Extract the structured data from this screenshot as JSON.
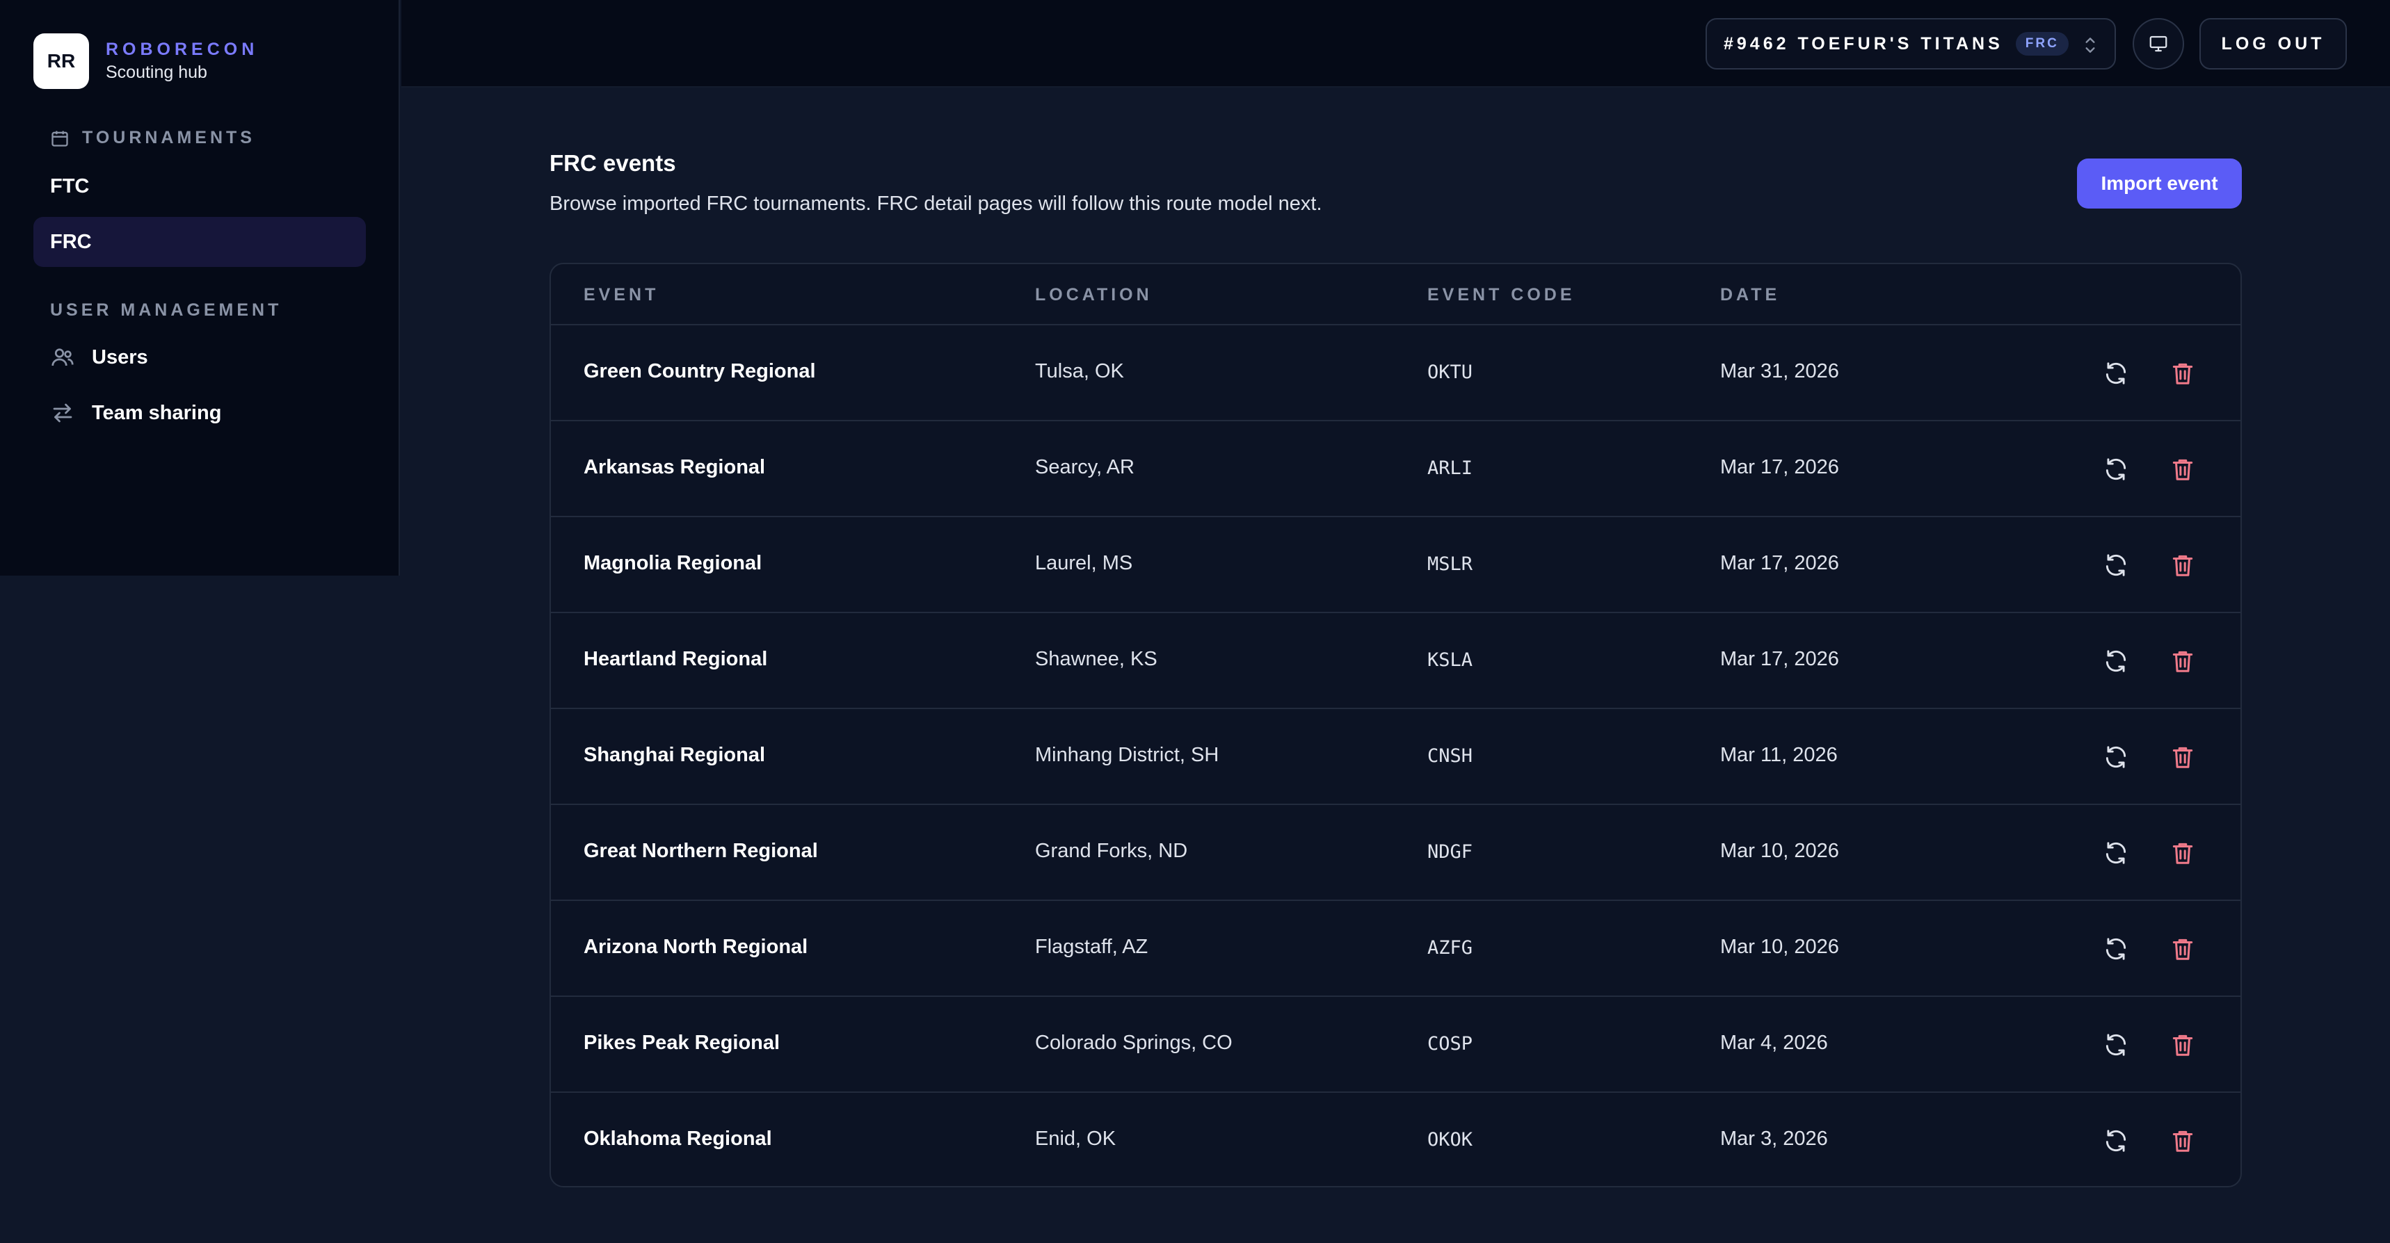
{
  "brand": {
    "logo": "RR",
    "name": "ROBORECON",
    "subtitle": "Scouting hub"
  },
  "sidebar": {
    "tournaments_label": "TOURNAMENTS",
    "tournaments": [
      {
        "label": "FTC",
        "active": false
      },
      {
        "label": "FRC",
        "active": true
      }
    ],
    "user_management_label": "USER MANAGEMENT",
    "user_items": [
      {
        "label": "Users",
        "icon": "users-icon"
      },
      {
        "label": "Team sharing",
        "icon": "swap-arrows-icon"
      }
    ]
  },
  "topbar": {
    "team_name": "#9462 TOEFUR'S TITANS",
    "team_badge": "FRC",
    "logout_label": "LOG OUT"
  },
  "main": {
    "title": "FRC events",
    "subtitle": "Browse imported FRC tournaments. FRC detail pages will follow this route model next.",
    "import_label": "Import event"
  },
  "table": {
    "columns": [
      "EVENT",
      "LOCATION",
      "EVENT CODE",
      "DATE"
    ],
    "rows": [
      {
        "event": "Green Country Regional",
        "location": "Tulsa, OK",
        "code": "OKTU",
        "date": "Mar 31, 2026"
      },
      {
        "event": "Arkansas Regional",
        "location": "Searcy, AR",
        "code": "ARLI",
        "date": "Mar 17, 2026"
      },
      {
        "event": "Magnolia Regional",
        "location": "Laurel, MS",
        "code": "MSLR",
        "date": "Mar 17, 2026"
      },
      {
        "event": "Heartland Regional",
        "location": "Shawnee, KS",
        "code": "KSLA",
        "date": "Mar 17, 2026"
      },
      {
        "event": "Shanghai Regional",
        "location": "Minhang District, SH",
        "code": "CNSH",
        "date": "Mar 11, 2026"
      },
      {
        "event": "Great Northern Regional",
        "location": "Grand Forks, ND",
        "code": "NDGF",
        "date": "Mar 10, 2026"
      },
      {
        "event": "Arizona North Regional",
        "location": "Flagstaff, AZ",
        "code": "AZFG",
        "date": "Mar 10, 2026"
      },
      {
        "event": "Pikes Peak Regional",
        "location": "Colorado Springs, CO",
        "code": "COSP",
        "date": "Mar 4, 2026"
      },
      {
        "event": "Oklahoma Regional",
        "location": "Enid, OK",
        "code": "OKOK",
        "date": "Mar 3, 2026"
      }
    ]
  },
  "colors": {
    "accent": "#5b5cf6",
    "brand": "#7b7bff",
    "delete": "#f07a8a",
    "background": "#0f1729",
    "sidebar": "#050a17"
  }
}
